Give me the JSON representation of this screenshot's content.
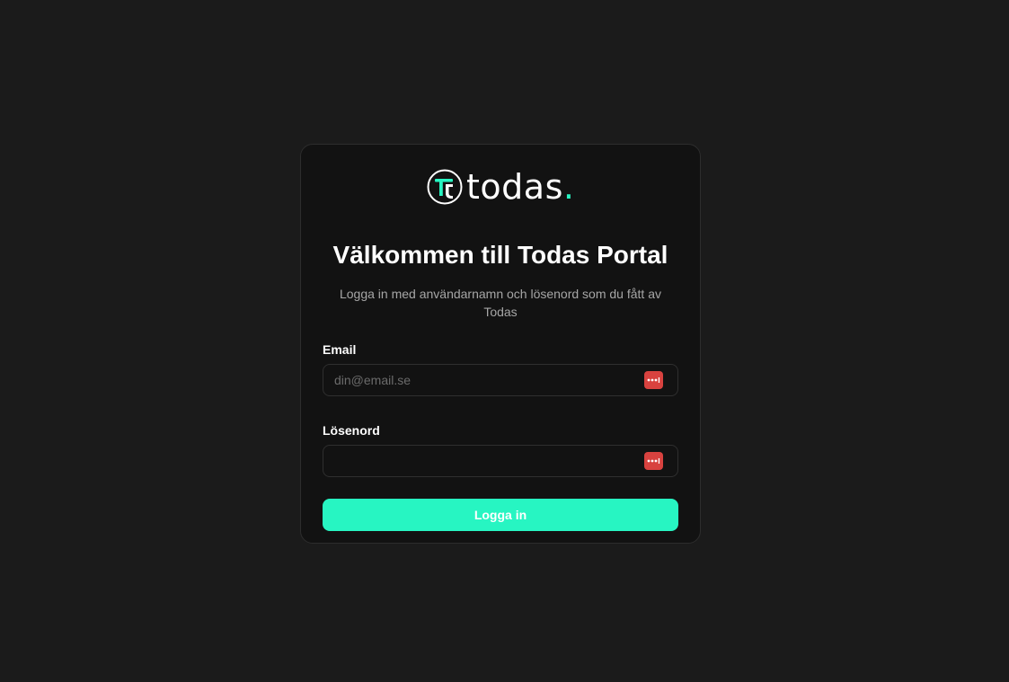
{
  "brand": {
    "name": "todas",
    "dot": ".",
    "accent_color": "#27f5c2",
    "logo_icon": "todas-logo-icon"
  },
  "login": {
    "title": "Välkommen till Todas Portal",
    "subtitle": "Logga in med användarnamn och lösenord som du fått av Todas",
    "email_label": "Email",
    "email_placeholder": "din@email.se",
    "email_value": "",
    "password_label": "Lösenord",
    "password_value": "",
    "submit_label": "Logga in",
    "password_manager_icon": "password-manager-icon",
    "password_manager_color": "#d8423f"
  },
  "colors": {
    "page_background": "#1b1b1b",
    "card_background": "#121212"
  }
}
